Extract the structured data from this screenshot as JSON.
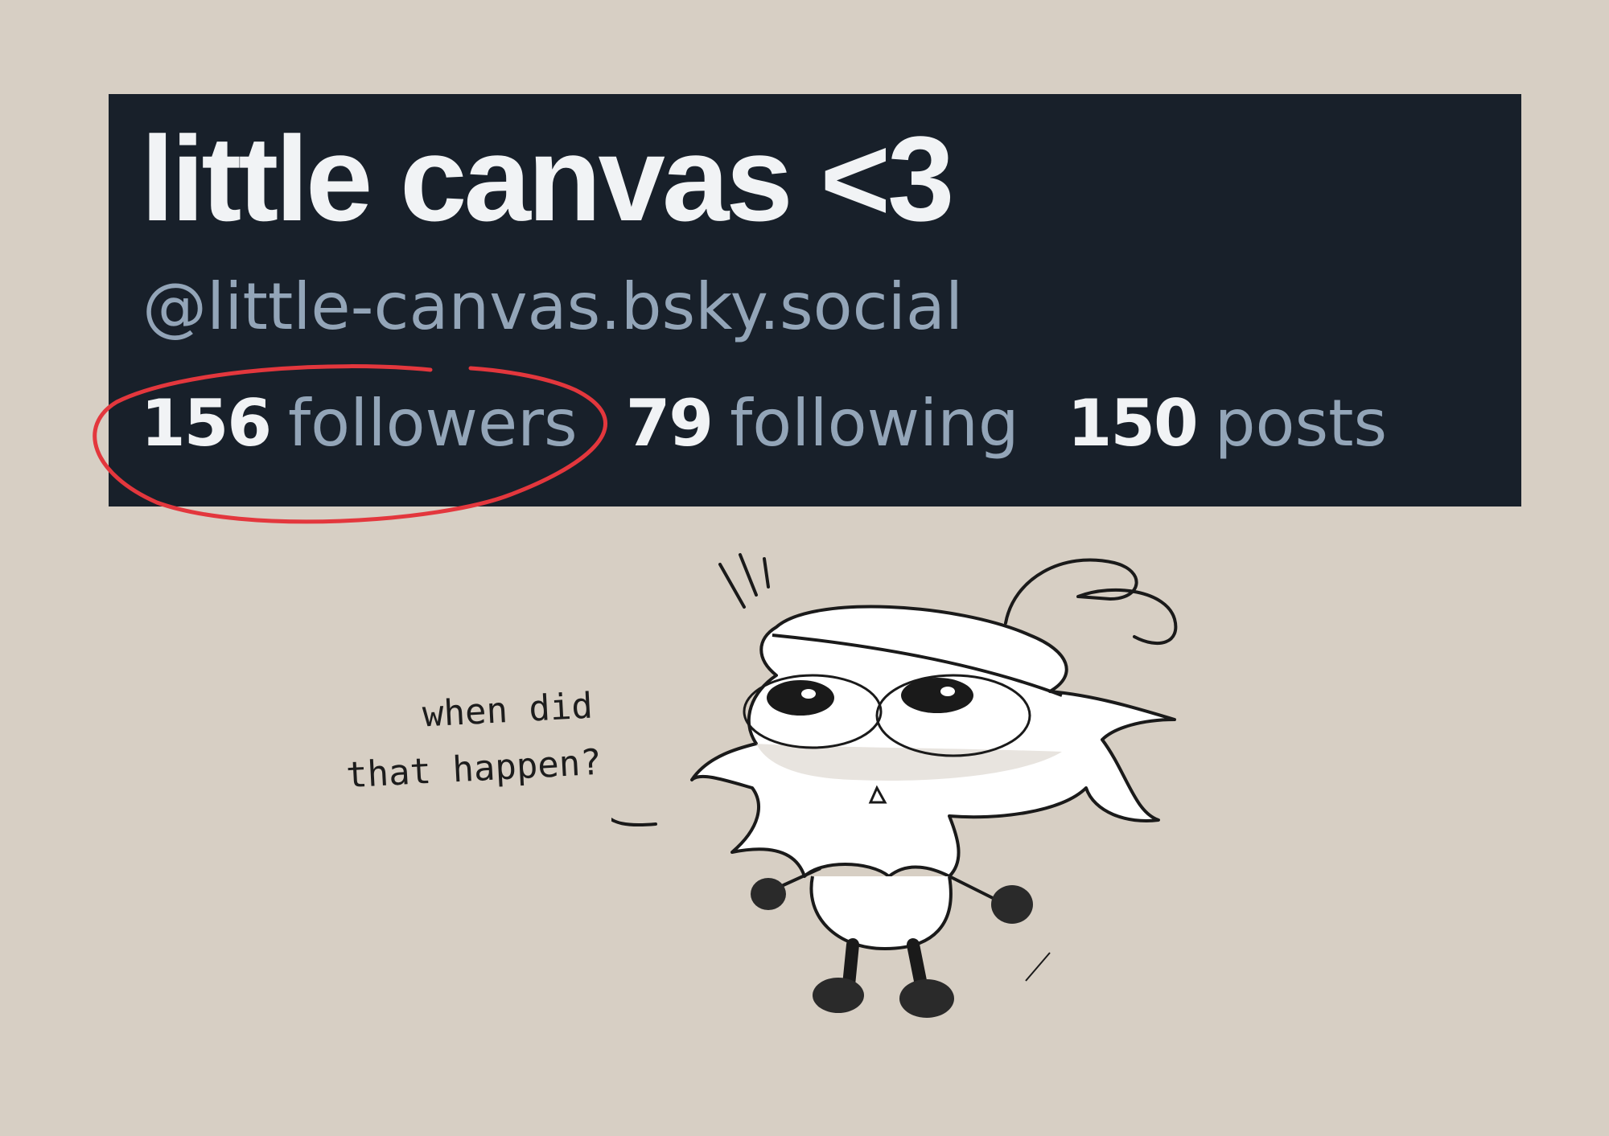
{
  "profile": {
    "display_name": "little canvas <3",
    "handle": "@little-canvas.bsky.social",
    "stats": {
      "followers": {
        "count": "156",
        "label": "followers"
      },
      "following": {
        "count": "79",
        "label": "following"
      },
      "posts": {
        "count": "150",
        "label": "posts"
      }
    }
  },
  "caption": {
    "line1": "when did",
    "line2": "that happen?"
  },
  "colors": {
    "background": "#d7cfc4",
    "card": "#18202a",
    "name_text": "#f1f3f5",
    "muted_text": "#93a5b8",
    "circle_annotation": "#e3373d"
  },
  "icons": [
    "hand-drawn-circle-annotation",
    "doodle-character-illustration"
  ]
}
